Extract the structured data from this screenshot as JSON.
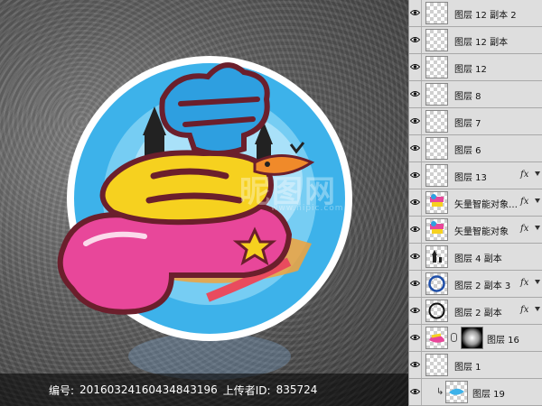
{
  "canvas": {
    "watermark_text": "昵图网",
    "watermark_url": "www.nipic.com",
    "artwork_glyph": "喜"
  },
  "info_bar": {
    "id_label": "编号:",
    "id_value": "20160324160434843196",
    "uploader_label": "上传者ID:",
    "uploader_value": "835724"
  },
  "layers": [
    {
      "name": "图层 12 副本 2",
      "fx": false,
      "thumb": "transparent"
    },
    {
      "name": "图层 12 副本",
      "fx": false,
      "thumb": "transparent"
    },
    {
      "name": "图层 12",
      "fx": false,
      "thumb": "transparent"
    },
    {
      "name": "图层 8",
      "fx": false,
      "thumb": "transparent"
    },
    {
      "name": "图层 7",
      "fx": false,
      "thumb": "transparent"
    },
    {
      "name": "图层 6",
      "fx": false,
      "thumb": "transparent"
    },
    {
      "name": "图层 13",
      "fx": true,
      "thumb": "transparent"
    },
    {
      "name": "矢量智能对象 ...",
      "fx": true,
      "thumb": "smart"
    },
    {
      "name": "矢量智能对象",
      "fx": true,
      "thumb": "smart"
    },
    {
      "name": "图层 4 副本",
      "fx": false,
      "thumb": "castle"
    },
    {
      "name": "图层 2 副本 3",
      "fx": true,
      "thumb": "ring-blue"
    },
    {
      "name": "图层 2 副本",
      "fx": true,
      "thumb": "ring-black"
    },
    {
      "name": "图层 16",
      "fx": false,
      "thumb": "masked"
    },
    {
      "name": "图层 1",
      "fx": false,
      "thumb": "transparent"
    },
    {
      "name": "图层 19",
      "fx": false,
      "thumb": "clip"
    }
  ],
  "fx_label": "fx",
  "colors": {
    "circle_blue": "#3db2ea",
    "circle_light": "#8fd8f7",
    "pink": "#e8479a",
    "yellow": "#f6d11f",
    "blue_glyph": "#2e9fe0"
  }
}
